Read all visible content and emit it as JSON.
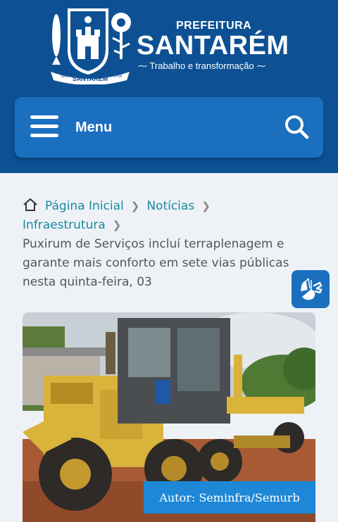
{
  "header": {
    "brand_top": "PREFEITURA",
    "brand_main": "SANTARÉM",
    "tagline": "Trabalho e transformação",
    "crest_text": "SANTARÉM",
    "crest_year_left": "1661",
    "crest_year_right": "1758",
    "colors": {
      "background": "#0d5194",
      "menu_bar": "#1b6fbf"
    }
  },
  "menu": {
    "label": "Menu",
    "icon": "hamburger-icon",
    "search_icon": "search-icon"
  },
  "breadcrumb": {
    "home_icon": "home-icon",
    "items": [
      "Página Inicial",
      "Notícias",
      "Infraestrutura"
    ],
    "current": "Puxirum de Serviços incluí terraplenagem e garante mais conforto em sete vias públicas nesta quinta-feira, 03"
  },
  "accessibility": {
    "icon": "sign-language-hands-icon"
  },
  "article": {
    "photo_credit": "Autor: Seminfra/Semurb",
    "photo_subject": "motor grader road machine"
  }
}
